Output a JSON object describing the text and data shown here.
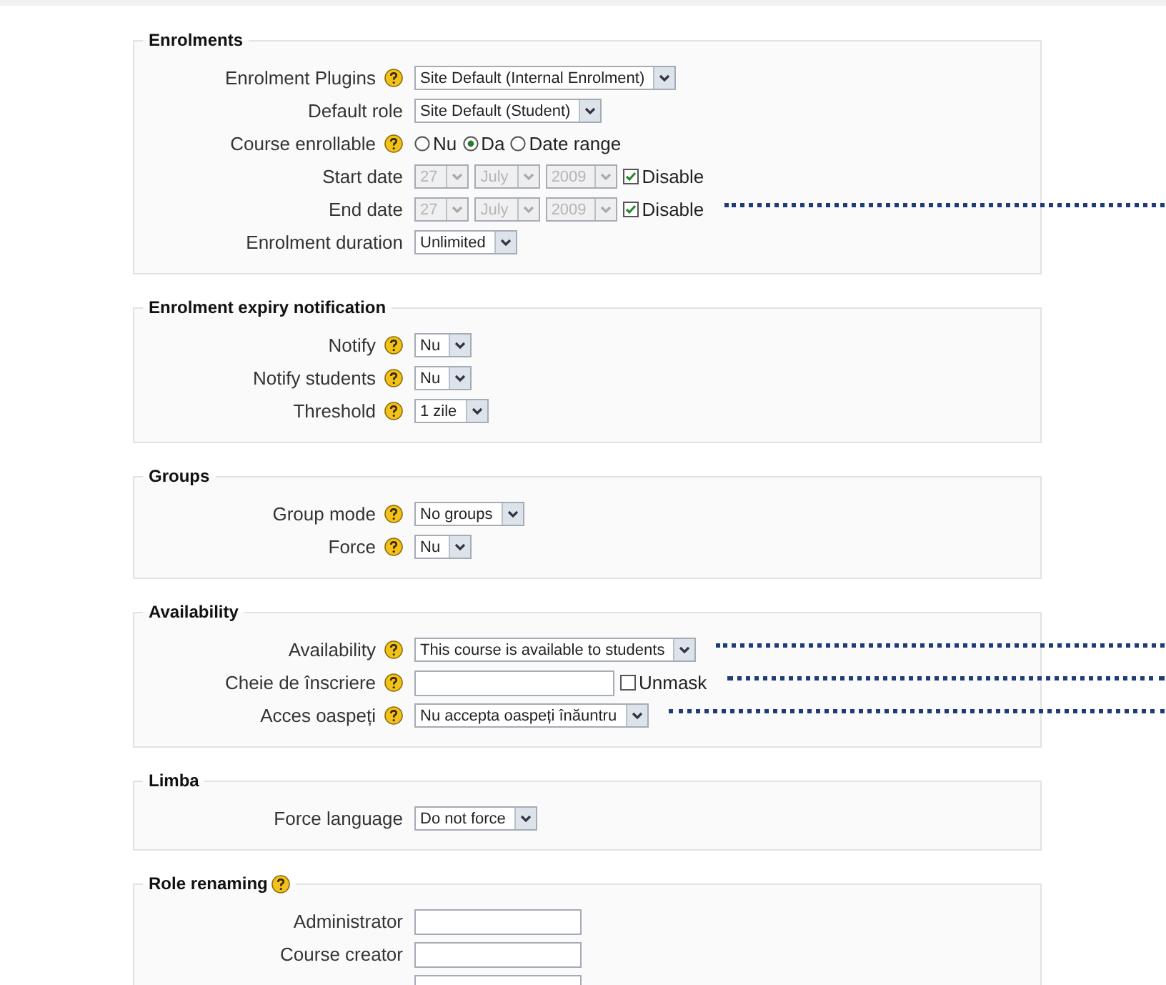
{
  "sections": [
    {
      "legend": "Enrolments",
      "help": false,
      "rows": [
        {
          "kind": "select",
          "label": "Enrolment Plugins",
          "help": true,
          "value": "Site Default (Internal Enrolment)",
          "leader": false
        },
        {
          "kind": "select",
          "label": "Default role",
          "help": false,
          "value": "Site Default (Student)",
          "leader": false
        },
        {
          "kind": "radio",
          "label": "Course enrollable",
          "help": true,
          "options": [
            {
              "label": "Nu",
              "selected": false
            },
            {
              "label": "Da",
              "selected": true
            },
            {
              "label": "Date range",
              "selected": false
            }
          ],
          "leader": false
        },
        {
          "kind": "date",
          "label": "Start date",
          "help": false,
          "fields": [
            {
              "value": "27",
              "disabled": true
            },
            {
              "value": "July",
              "disabled": true
            },
            {
              "value": "2009",
              "disabled": true
            }
          ],
          "checkbox": {
            "label": "Disable",
            "checked": true
          },
          "leader": false
        },
        {
          "kind": "date",
          "label": "End date",
          "help": false,
          "fields": [
            {
              "value": "27",
              "disabled": true
            },
            {
              "value": "July",
              "disabled": true
            },
            {
              "value": "2009",
              "disabled": true
            }
          ],
          "checkbox": {
            "label": "Disable",
            "checked": true
          },
          "leader": true
        },
        {
          "kind": "select",
          "label": "Enrolment duration",
          "help": false,
          "value": "Unlimited",
          "leader": false
        }
      ]
    },
    {
      "legend": "Enrolment expiry notification",
      "help": false,
      "rows": [
        {
          "kind": "select",
          "label": "Notify",
          "help": true,
          "value": "Nu",
          "leader": false
        },
        {
          "kind": "select",
          "label": "Notify students",
          "help": true,
          "value": "Nu",
          "leader": false
        },
        {
          "kind": "select",
          "label": "Threshold",
          "help": true,
          "value": "1 zile",
          "leader": false
        }
      ]
    },
    {
      "legend": "Groups",
      "help": false,
      "rows": [
        {
          "kind": "select",
          "label": "Group mode",
          "help": true,
          "value": "No groups",
          "leader": false
        },
        {
          "kind": "select",
          "label": "Force",
          "help": true,
          "value": "Nu",
          "leader": false
        }
      ]
    },
    {
      "legend": "Availability",
      "help": false,
      "rows": [
        {
          "kind": "select",
          "label": "Availability",
          "help": true,
          "value": "This course is available to students",
          "leader": true
        },
        {
          "kind": "text",
          "label": "Cheie de înscriere",
          "help": true,
          "checkbox": {
            "label": "Unmask",
            "checked": false
          },
          "leader": true
        },
        {
          "kind": "select",
          "label": "Acces oaspeți",
          "help": true,
          "value": "Nu accepta oaspeți înăuntru",
          "leader": true
        }
      ]
    },
    {
      "legend": "Limba",
      "help": false,
      "rows": [
        {
          "kind": "select",
          "label": "Force language",
          "help": false,
          "value": "Do not force",
          "leader": false
        }
      ]
    },
    {
      "legend": "Role renaming",
      "help": true,
      "rows": [
        {
          "kind": "text",
          "label": "Administrator",
          "help": false,
          "leader": false
        },
        {
          "kind": "text",
          "label": "Course creator",
          "help": false,
          "leader": false
        },
        {
          "kind": "text",
          "help": false,
          "leader": false
        }
      ]
    }
  ]
}
